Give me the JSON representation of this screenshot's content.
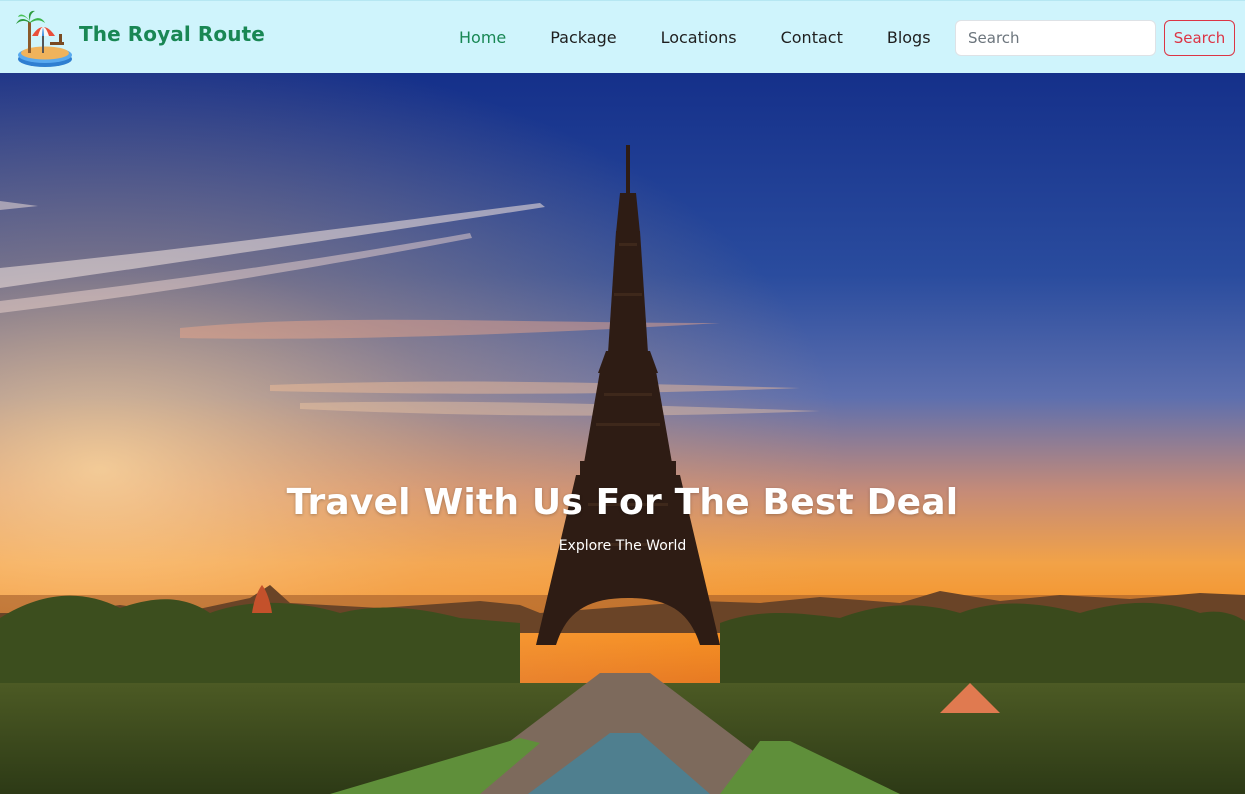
{
  "brand": {
    "name": "The Royal Route",
    "logo_icon": "beach-island-icon"
  },
  "nav": {
    "items": [
      {
        "label": "Home",
        "active": true
      },
      {
        "label": "Package",
        "active": false
      },
      {
        "label": "Locations",
        "active": false
      },
      {
        "label": "Contact",
        "active": false
      },
      {
        "label": "Blogs",
        "active": false
      }
    ]
  },
  "search": {
    "placeholder": "Search",
    "value": "",
    "button_label": "Search"
  },
  "hero": {
    "title": "Travel With Us For The Best Deal",
    "subtitle": "Explore The World"
  },
  "colors": {
    "navbar_bg": "#cff4fc",
    "brand_green": "#198754",
    "search_button_red": "#dc3545",
    "sky_top": "#17318a",
    "sunset_orange": "#f39a2a"
  }
}
